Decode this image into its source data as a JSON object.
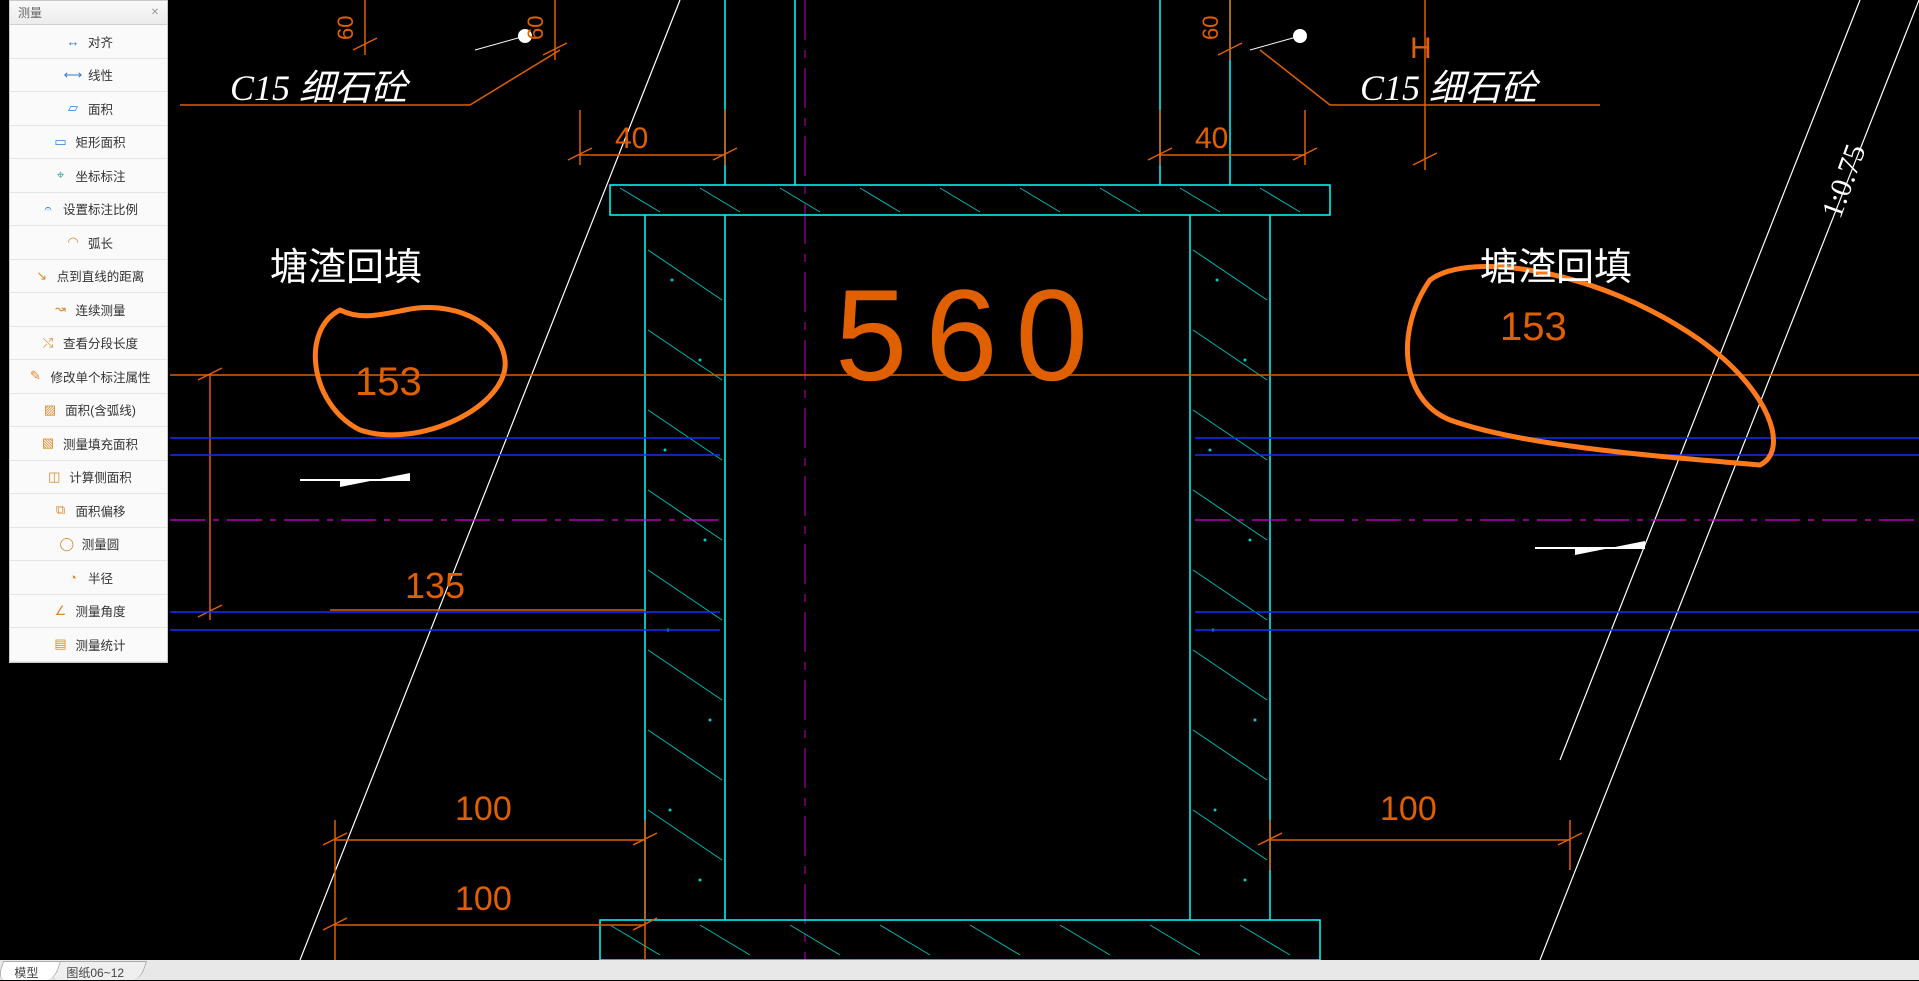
{
  "toolbox": {
    "title": "测量",
    "items": [
      {
        "name": "align",
        "label": "对齐"
      },
      {
        "name": "linear",
        "label": "线性"
      },
      {
        "name": "area",
        "label": "面积"
      },
      {
        "name": "rect-area",
        "label": "矩形面积"
      },
      {
        "name": "coord",
        "label": "坐标标注"
      },
      {
        "name": "scale",
        "label": "设置标注比例"
      },
      {
        "name": "arc",
        "label": "弧长"
      },
      {
        "name": "point-line",
        "label": "点到直线的距离"
      },
      {
        "name": "continuous",
        "label": "连续测量"
      },
      {
        "name": "segment",
        "label": "查看分段长度"
      },
      {
        "name": "edit-dim",
        "label": "修改单个标注属性"
      },
      {
        "name": "area-arc",
        "label": "面积(含弧线)"
      },
      {
        "name": "fill-area",
        "label": "测量填充面积"
      },
      {
        "name": "side-area",
        "label": "计算侧面积"
      },
      {
        "name": "offset",
        "label": "面积偏移"
      },
      {
        "name": "circle",
        "label": "测量圆"
      },
      {
        "name": "radius",
        "label": "半径"
      },
      {
        "name": "angle",
        "label": "测量角度"
      },
      {
        "name": "stat",
        "label": "测量统计"
      }
    ]
  },
  "tabs": {
    "items": [
      {
        "name": "model",
        "label": "模型",
        "active": true
      },
      {
        "name": "sheet",
        "label": "图纸06~12",
        "active": false
      }
    ]
  },
  "drawing": {
    "texts": {
      "c15_left": "C15 细石砼",
      "c15_right": "C15 细石砼",
      "fill_left": "塘渣回填",
      "fill_right": "塘渣回填",
      "big": "560",
      "v153_left": "153",
      "v153_right": "153",
      "v135": "135",
      "v100a": "100",
      "v100b": "100",
      "v100c": "100",
      "v40a": "40",
      "v40b": "40",
      "v60a": "60",
      "v60b": "60",
      "v60c": "60",
      "slope": "1:0.75",
      "H": "H"
    }
  }
}
